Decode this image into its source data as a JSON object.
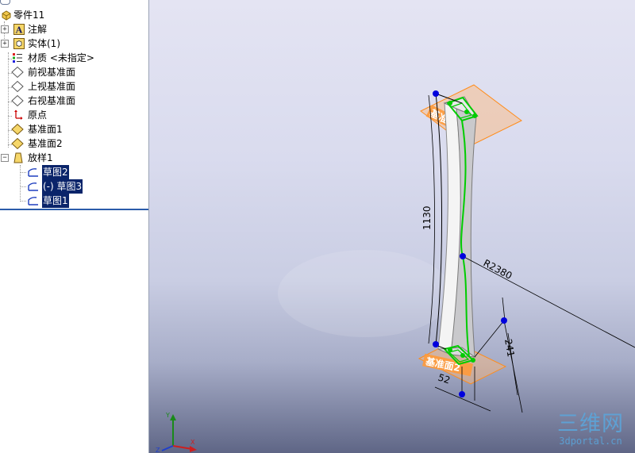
{
  "feature_tree": {
    "part_name": "零件11",
    "items": [
      {
        "label": "注解",
        "icon": "annotations-icon"
      },
      {
        "label": "实体(1)",
        "icon": "solid-bodies-icon"
      },
      {
        "label": "材质 <未指定>",
        "icon": "material-icon"
      },
      {
        "label": "前视基准面",
        "icon": "plane-icon"
      },
      {
        "label": "上视基准面",
        "icon": "plane-icon"
      },
      {
        "label": "右视基准面",
        "icon": "plane-icon"
      },
      {
        "label": "原点",
        "icon": "origin-icon"
      },
      {
        "label": "基准面1",
        "icon": "reference-plane-icon"
      },
      {
        "label": "基准面2",
        "icon": "reference-plane-icon"
      },
      {
        "label": "放样1",
        "icon": "loft-feature-icon"
      }
    ],
    "loft_children": [
      {
        "label": "草图2",
        "icon": "sketch-icon",
        "selected": true
      },
      {
        "label": "(-) 草图3",
        "icon": "sketch-icon",
        "selected": true
      },
      {
        "label": "草图1",
        "icon": "sketch-icon",
        "selected": true
      }
    ],
    "expander_collapsed": "+",
    "expander_expanded": "−"
  },
  "viewport": {
    "dimensions": {
      "length": "1130",
      "radius": "R2380",
      "height": "241",
      "width": "52"
    },
    "plane_labels": {
      "top_plane": "基准面1",
      "bottom_plane": "基准面2"
    },
    "triad_axes": {
      "x": "X",
      "y": "Y",
      "z": "Z"
    }
  },
  "watermark": {
    "logo": "三维网",
    "site": "3dportal.cn"
  },
  "colors": {
    "selection": "#0a246a",
    "sketch_green": "#00cc00",
    "plane_orange": "#ff8c1a",
    "point_blue": "#0000dd",
    "watermark": "#5aa7dd"
  }
}
